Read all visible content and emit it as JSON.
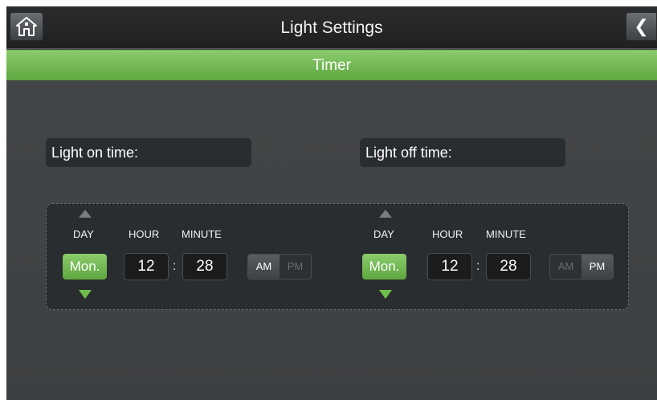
{
  "header": {
    "title": "Light Settings",
    "home_icon": "home-icon",
    "back_icon": "chevron-left-icon",
    "back_glyph": "❮"
  },
  "subheader": {
    "title": "Timer"
  },
  "on_timer": {
    "label": "Light on time:",
    "day_label": "DAY",
    "hour_label": "HOUR",
    "minute_label": "MINUTE",
    "day": "Mon.",
    "hour": "12",
    "separator": ":",
    "minute": "28",
    "am": "AM",
    "pm": "PM",
    "selected_period": "AM"
  },
  "off_timer": {
    "label": "Light off time:",
    "day_label": "DAY",
    "hour_label": "HOUR",
    "minute_label": "MINUTE",
    "day": "Mon.",
    "hour": "12",
    "separator": ":",
    "minute": "28",
    "am": "AM",
    "pm": "PM",
    "selected_period": "PM"
  },
  "colors": {
    "accent_green": "#6fbf4c",
    "background": "#414446",
    "panel": "#2a2d2f"
  }
}
